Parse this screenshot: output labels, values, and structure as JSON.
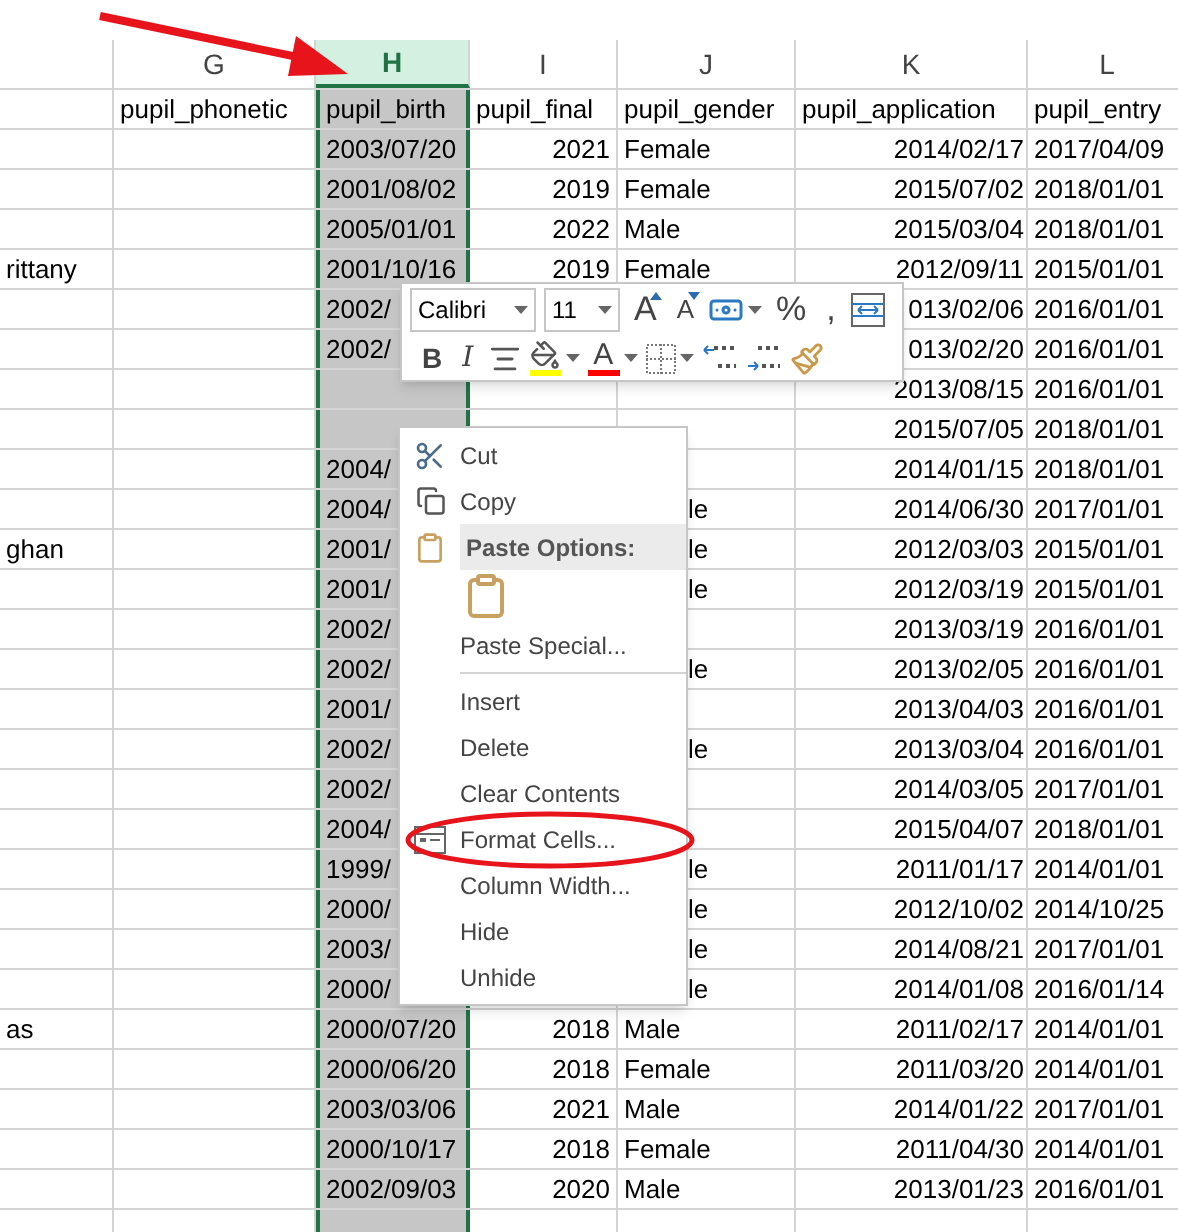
{
  "column_letters": [
    {
      "letter": "G",
      "selected": false
    },
    {
      "letter": "H",
      "selected": true
    },
    {
      "letter": "I",
      "selected": false
    },
    {
      "letter": "J",
      "selected": false
    },
    {
      "letter": "K",
      "selected": false
    },
    {
      "letter": "L",
      "selected": false
    }
  ],
  "field_names": {
    "column_g": "pupil_phonetic",
    "column_h": "pupil_birth",
    "column_i": "pupil_final",
    "column_j": "pupil_gender",
    "column_k": "pupil_application",
    "column_l": "pupil_entry"
  },
  "rows": [
    {
      "column_h": "2003/07/20",
      "column_i": "2021",
      "column_j": "Female",
      "column_k": "2014/02/17",
      "column_l": "2017/04/09"
    },
    {
      "column_h": "2001/08/02",
      "column_i": "2019",
      "column_j": "Female",
      "column_k": "2015/07/02",
      "column_l": "2018/01/01"
    },
    {
      "column_h": "2005/01/01",
      "column_i": "2022",
      "column_j": "Male",
      "column_k": "2015/03/04",
      "column_l": "2018/01/01"
    },
    {
      "column_f": "rittany",
      "column_h": "2001/10/16",
      "column_i": "2019",
      "column_j": "Female",
      "column_k": "2012/09/11",
      "column_l": "2015/01/01"
    },
    {
      "column_h": "2002/",
      "column_k": "013/02/06",
      "column_l": "2016/01/01"
    },
    {
      "column_h": "2002/",
      "column_k": "013/02/20",
      "column_l": "2016/01/01"
    },
    {
      "column_k": "2013/08/15",
      "column_l": "2016/01/01"
    },
    {
      "column_k": "2015/07/05",
      "column_l": "2018/01/01"
    },
    {
      "column_h": "2004/",
      "column_k": "2014/01/15",
      "column_l": "2018/01/01"
    },
    {
      "column_h": "2004/",
      "column_j_tail": "le",
      "column_k": "2014/06/30",
      "column_l": "2017/01/01"
    },
    {
      "column_f": "ghan",
      "column_h": "2001/",
      "column_j_tail": "le",
      "column_k": "2012/03/03",
      "column_l": "2015/01/01"
    },
    {
      "column_h": "2001/",
      "column_j_tail": "le",
      "column_k": "2012/03/19",
      "column_l": "2015/01/01"
    },
    {
      "column_h": "2002/",
      "column_k": "2013/03/19",
      "column_l": "2016/01/01"
    },
    {
      "column_h": "2002/",
      "column_j_tail": "le",
      "column_k": "2013/02/05",
      "column_l": "2016/01/01"
    },
    {
      "column_h": "2001/",
      "column_k": "2013/04/03",
      "column_l": "2016/01/01"
    },
    {
      "column_h": "2002/",
      "column_j_tail": "le",
      "column_k": "2013/03/04",
      "column_l": "2016/01/01"
    },
    {
      "column_h": "2002/",
      "column_k": "2014/03/05",
      "column_l": "2017/01/01"
    },
    {
      "column_h": "2004/",
      "column_k": "2015/04/07",
      "column_l": "2018/01/01"
    },
    {
      "column_h": "1999/",
      "column_j_tail": "le",
      "column_k": "2011/01/17",
      "column_l": "2014/01/01"
    },
    {
      "column_h": "2000/",
      "column_j_tail": "le",
      "column_k": "2012/10/02",
      "column_l": "2014/10/25"
    },
    {
      "column_h": "2003/",
      "column_j_tail": "le",
      "column_k": "2014/08/21",
      "column_l": "2017/01/01"
    },
    {
      "column_h": "2000/",
      "column_j_tail": "le",
      "column_k": "2014/01/08",
      "column_l": "2016/01/14"
    },
    {
      "column_f": "as",
      "column_h": "2000/07/20",
      "column_i": "2018",
      "column_j": "Male",
      "column_k": "2011/02/17",
      "column_l": "2014/01/01"
    },
    {
      "column_h": "2000/06/20",
      "column_i": "2018",
      "column_j": "Female",
      "column_k": "2011/03/20",
      "column_l": "2014/01/01"
    },
    {
      "column_h": "2003/03/06",
      "column_i": "2021",
      "column_j": "Male",
      "column_k": "2014/01/22",
      "column_l": "2017/01/01"
    },
    {
      "column_h": "2000/10/17",
      "column_i": "2018",
      "column_j": "Female",
      "column_k": "2011/04/30",
      "column_l": "2014/01/01"
    },
    {
      "column_h": "2002/09/03",
      "column_i": "2020",
      "column_j": "Male",
      "column_k": "2013/01/23",
      "column_l": "2016/01/01"
    }
  ],
  "mini_toolbar": {
    "font": "Calibri",
    "size": "11",
    "row_1": [
      {
        "kind": "grow-font",
        "label": "A"
      },
      {
        "kind": "shrink-font",
        "label": "A"
      },
      {
        "kind": "accounting"
      },
      {
        "kind": "char",
        "label": "%"
      },
      {
        "kind": "char",
        "label": ","
      },
      {
        "kind": "wrap"
      }
    ],
    "row_2": [
      {
        "kind": "bold",
        "label": "B"
      },
      {
        "kind": "italic",
        "label": "I"
      },
      {
        "kind": "align"
      },
      {
        "kind": "fill"
      },
      {
        "kind": "font-color",
        "label": "A"
      },
      {
        "kind": "borders"
      },
      {
        "kind": "increase-decimal"
      },
      {
        "kind": "decrease-decimal"
      },
      {
        "kind": "painter"
      }
    ]
  },
  "context_menu": [
    {
      "kind": "cut",
      "label": "Cut"
    },
    {
      "kind": "copy",
      "label": "Copy"
    },
    {
      "kind": "header",
      "label": "Paste Options:"
    },
    {
      "kind": "paste-choice"
    },
    {
      "kind": "item",
      "label": "Paste Special..."
    },
    {
      "kind": "separator"
    },
    {
      "kind": "item",
      "label": "Insert"
    },
    {
      "kind": "item",
      "label": "Delete"
    },
    {
      "kind": "item",
      "label": "Clear Contents"
    },
    {
      "kind": "format-cells",
      "label": "Format Cells...",
      "circled": true
    },
    {
      "kind": "item",
      "label": "Column Width..."
    },
    {
      "kind": "item",
      "label": "Hide"
    },
    {
      "kind": "item",
      "label": "Unhide"
    }
  ]
}
